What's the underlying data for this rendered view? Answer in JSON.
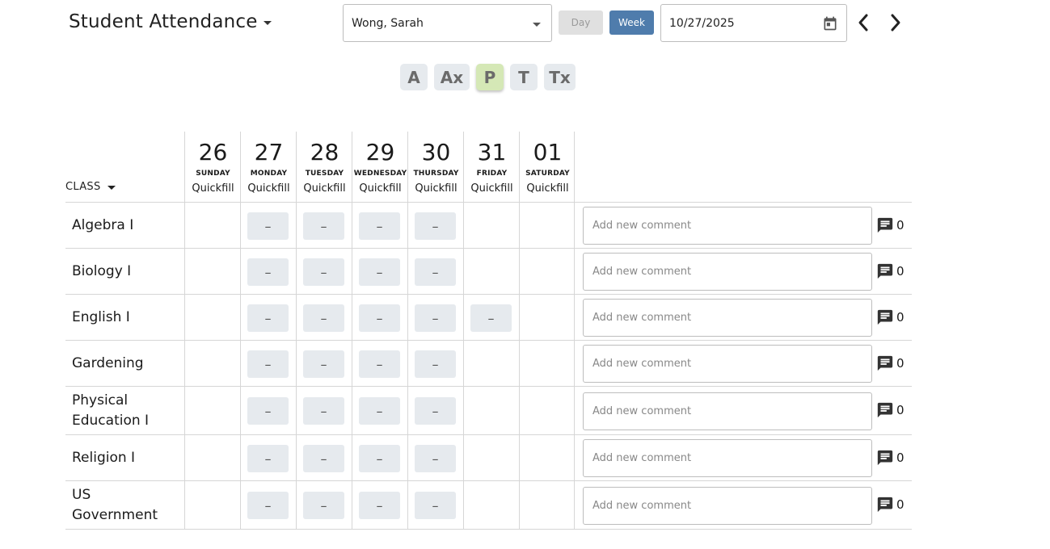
{
  "header": {
    "title": "Student Attendance",
    "student": "Wong, Sarah",
    "day_label": "Day",
    "week_label": "Week",
    "date": "10/27/2025"
  },
  "icons": {
    "title_menu": "caret-down-icon",
    "student_dropdown": "caret-down-icon",
    "calendar": "calendar-icon",
    "prev": "chevron-left-icon",
    "next": "chevron-right-icon",
    "comment": "comment-icon"
  },
  "status_codes": [
    "A",
    "Ax",
    "P",
    "T",
    "Tx"
  ],
  "selected_status": "P",
  "colors": {
    "week_button": "#4f7cac",
    "selected_chip": "#d5e8b6",
    "chip": "#e6eaee"
  },
  "table": {
    "class_header": "CLASS",
    "quickfill_label": "Quickfill",
    "days": [
      {
        "num": "26",
        "name": "SUNDAY"
      },
      {
        "num": "27",
        "name": "MONDAY"
      },
      {
        "num": "28",
        "name": "TUESDAY"
      },
      {
        "num": "29",
        "name": "WEDNESDAY"
      },
      {
        "num": "30",
        "name": "THURSDAY"
      },
      {
        "num": "31",
        "name": "FRIDAY"
      },
      {
        "num": "01",
        "name": "SATURDAY"
      }
    ],
    "comment_placeholder": "Add new comment",
    "rows": [
      {
        "class": "Algebra I",
        "marks": [
          "",
          "–",
          "–",
          "–",
          "–",
          "",
          ""
        ],
        "comments": "0"
      },
      {
        "class": "Biology I",
        "marks": [
          "",
          "–",
          "–",
          "–",
          "–",
          "",
          ""
        ],
        "comments": "0"
      },
      {
        "class": "English I",
        "marks": [
          "",
          "–",
          "–",
          "–",
          "–",
          "–",
          ""
        ],
        "comments": "0"
      },
      {
        "class": "Gardening",
        "marks": [
          "",
          "–",
          "–",
          "–",
          "–",
          "",
          ""
        ],
        "comments": "0"
      },
      {
        "class": "Physical Education I",
        "marks": [
          "",
          "–",
          "–",
          "–",
          "–",
          "",
          ""
        ],
        "comments": "0"
      },
      {
        "class": "Religion I",
        "marks": [
          "",
          "–",
          "–",
          "–",
          "–",
          "",
          ""
        ],
        "comments": "0"
      },
      {
        "class": "US Government",
        "marks": [
          "",
          "–",
          "–",
          "–",
          "–",
          "",
          ""
        ],
        "comments": "0"
      }
    ]
  }
}
